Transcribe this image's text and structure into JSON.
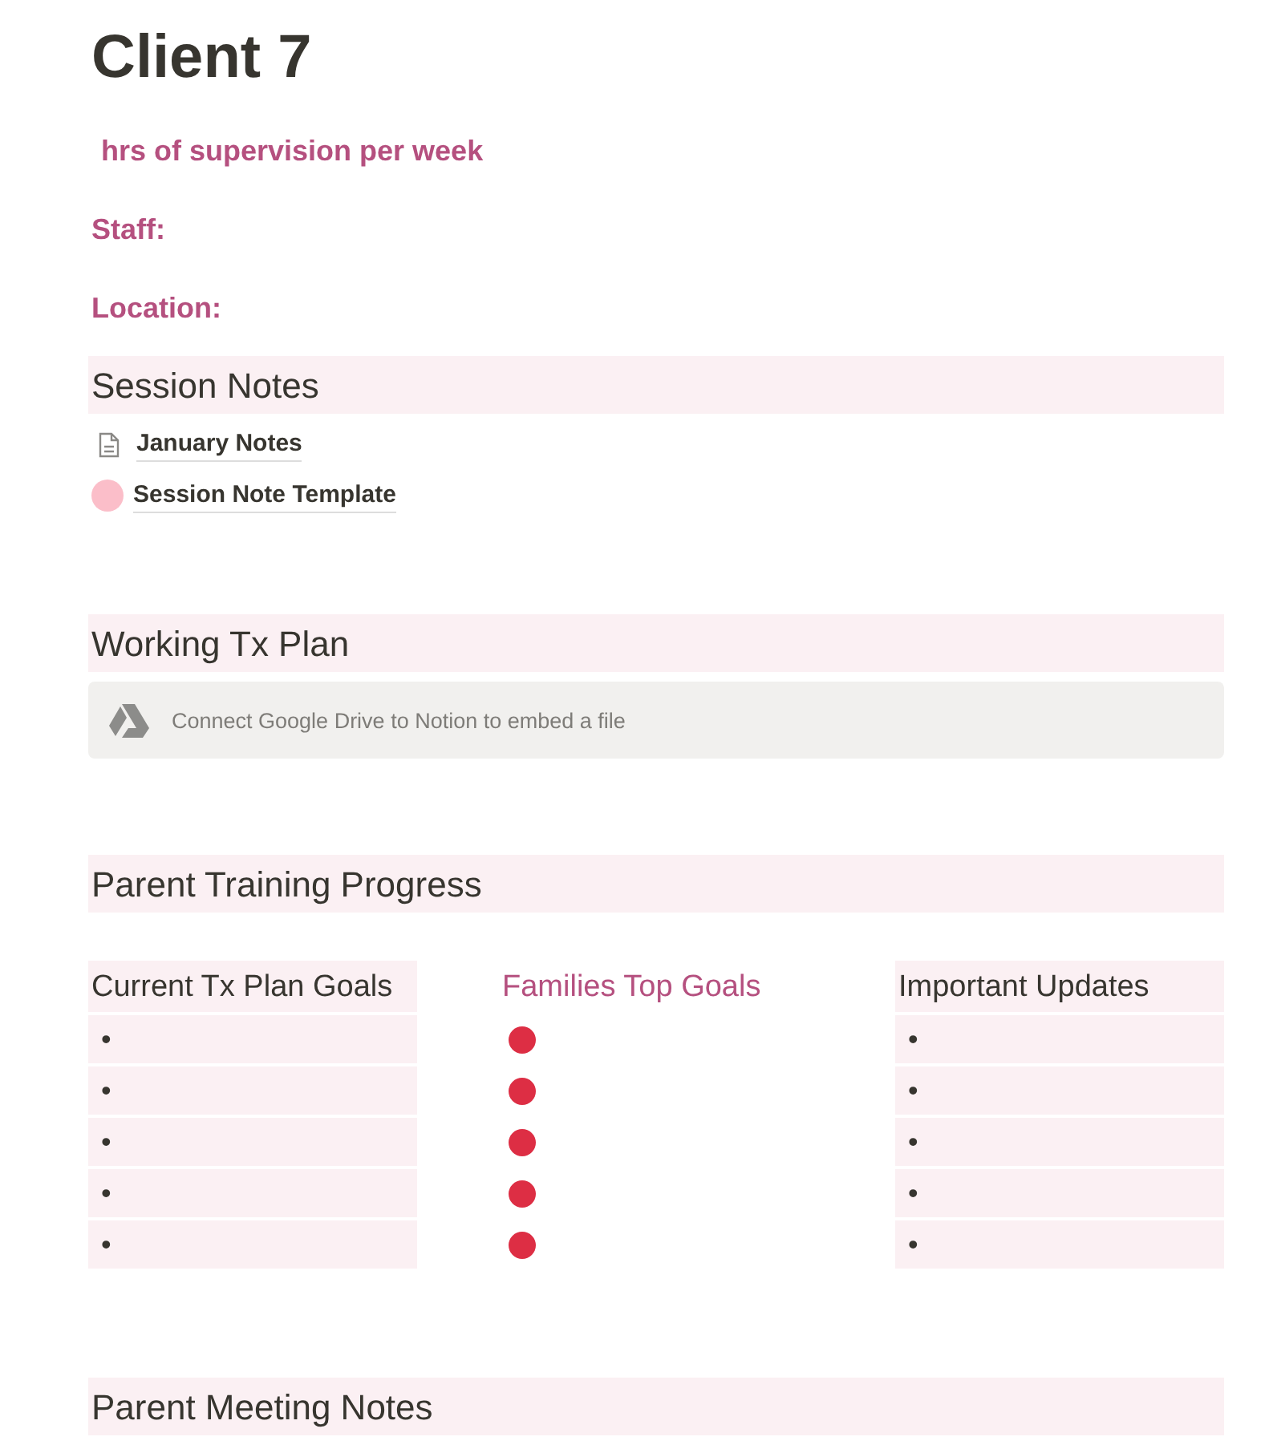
{
  "page": {
    "title": "Client 7"
  },
  "properties": [
    {
      "text": "hrs of supervision per week",
      "indented": true
    },
    {
      "text": "Staff:",
      "indented": false
    },
    {
      "text": "Location:",
      "indented": false
    }
  ],
  "session_notes": {
    "heading": "Session Notes",
    "pages": [
      {
        "kind": "document",
        "title": "January Notes"
      },
      {
        "kind": "circle",
        "title": "Session Note Template",
        "color": "#fbbec9"
      }
    ]
  },
  "working_tx_plan": {
    "heading": "Working Tx Plan",
    "embed": {
      "text": "Connect Google Drive to Notion to embed a file"
    }
  },
  "parent_training": {
    "heading": "Parent Training Progress",
    "columns": [
      {
        "heading": "Current Tx Plan Goals",
        "kind": "highlighted",
        "items": [
          {
            "kind": "bullet",
            "text": "•"
          },
          {
            "kind": "bullet",
            "text": "•"
          },
          {
            "kind": "bullet",
            "text": "•"
          },
          {
            "kind": "bullet",
            "text": "•"
          },
          {
            "kind": "bullet",
            "text": "•"
          }
        ]
      },
      {
        "heading": "Families Top Goals",
        "kind": "plain",
        "items": [
          {
            "kind": "dot",
            "color": "#dd2e44"
          },
          {
            "kind": "dot",
            "color": "#dd2e44"
          },
          {
            "kind": "dot",
            "color": "#dd2e44"
          },
          {
            "kind": "dot",
            "color": "#dd2e44"
          },
          {
            "kind": "dot",
            "color": "#dd2e44"
          }
        ]
      },
      {
        "heading": "Important Updates",
        "kind": "highlighted",
        "items": [
          {
            "kind": "bullet",
            "text": "•"
          },
          {
            "kind": "bullet",
            "text": "•"
          },
          {
            "kind": "bullet",
            "text": "•"
          },
          {
            "kind": "bullet",
            "text": "•"
          },
          {
            "kind": "bullet",
            "text": "•"
          }
        ]
      }
    ]
  },
  "parent_meeting_notes": {
    "heading": "Parent Meeting Notes"
  }
}
